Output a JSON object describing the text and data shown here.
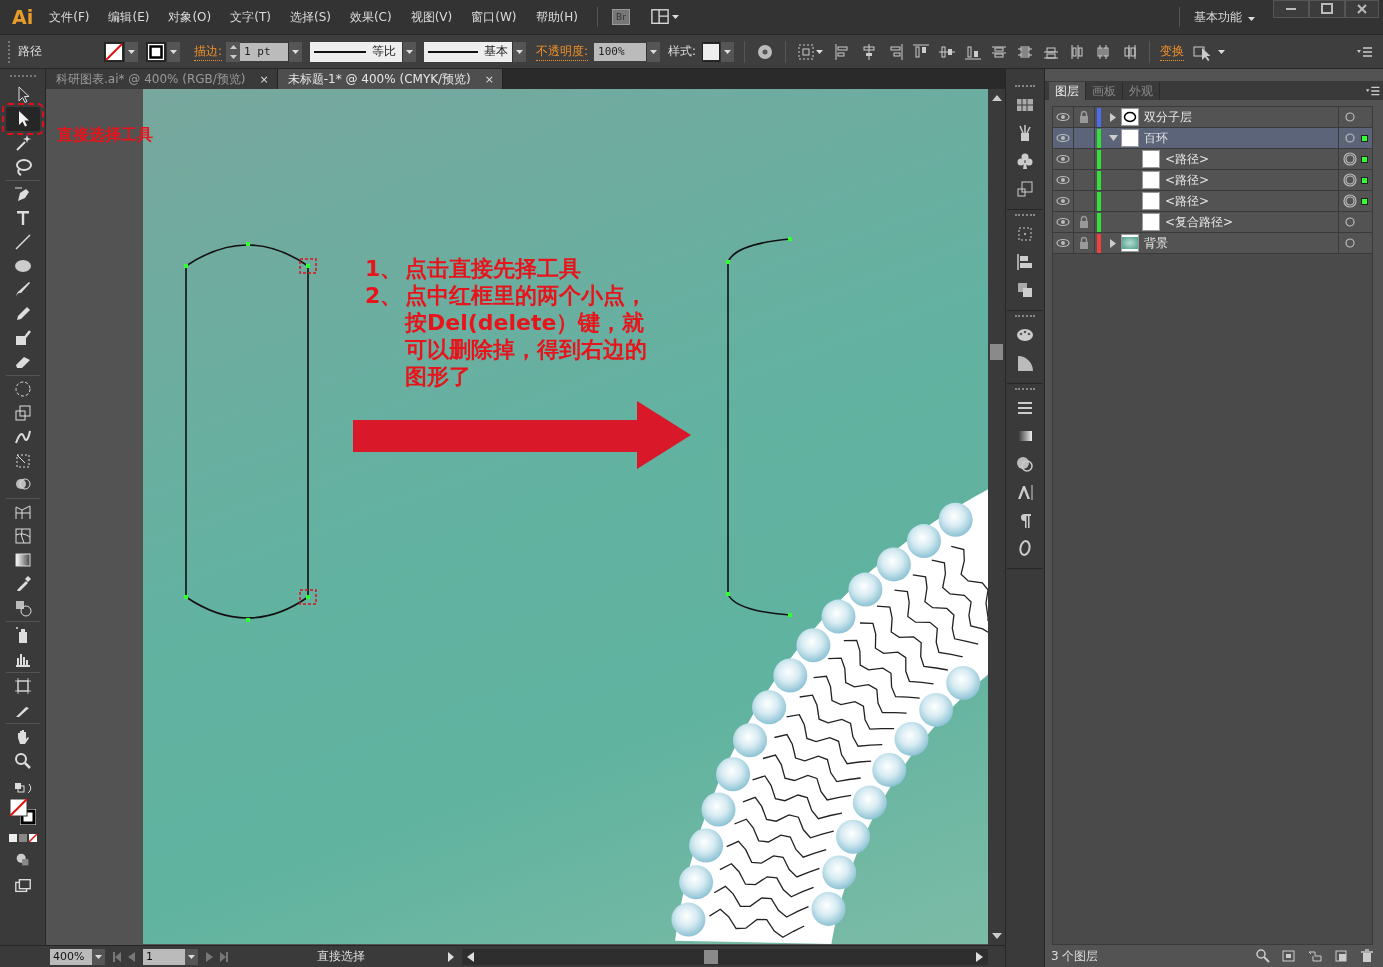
{
  "app": {
    "logo": "Ai"
  },
  "menu": [
    "文件(F)",
    "编辑(E)",
    "对象(O)",
    "文字(T)",
    "选择(S)",
    "效果(C)",
    "视图(V)",
    "窗口(W)",
    "帮助(H)"
  ],
  "bridge_button": "Br",
  "workspace": "基本功能",
  "control_bar": {
    "selection": "路径",
    "stroke_label": "描边:",
    "stroke_weight": "1 pt",
    "profile": "等比",
    "brush": "基本",
    "opacity_label": "不透明度:",
    "opacity": "100%",
    "style_label": "样式:",
    "transform": "变换"
  },
  "doc_tabs": [
    {
      "title": "科研图表.ai* @ 400% (RGB/预览)",
      "close": "×",
      "selected": false
    },
    {
      "title": "未标题-1* @ 400% (CMYK/预览)",
      "close": "×",
      "selected": true
    }
  ],
  "tools": [
    {
      "selected": false
    },
    {
      "selected": true
    },
    {
      "selected": false
    },
    {
      "selected": false
    },
    {
      "selected": false
    },
    {
      "selected": false
    },
    {
      "selected": false
    },
    {
      "selected": false
    },
    {
      "selected": false
    },
    {
      "selected": false
    },
    {
      "selected": false
    },
    {
      "selected": false
    },
    {
      "selected": false
    },
    {
      "selected": false
    },
    {
      "selected": false
    },
    {
      "selected": false
    },
    {
      "selected": false
    },
    {
      "selected": false
    },
    {
      "selected": false
    },
    {
      "selected": false
    },
    {
      "selected": false
    },
    {
      "selected": false
    },
    {
      "selected": false
    },
    {
      "selected": false
    },
    {
      "selected": false
    },
    {
      "selected": false
    },
    {
      "selected": false
    },
    {
      "selected": false
    }
  ],
  "canvas": {
    "callout": "直接选择工具",
    "steps": [
      {
        "number": "1、",
        "text": "点击直接先择工具"
      },
      {
        "number": "2、",
        "text": "点中红框里的两个小点，按Del(delete）键，就可以删除掉，得到右边的图形了"
      }
    ]
  },
  "layers": {
    "tabs": [
      {
        "label": "图层",
        "selected": true
      },
      {
        "label": "画板",
        "selected": false
      },
      {
        "label": "外观",
        "selected": false
      }
    ],
    "rows": [
      {
        "name": "双分子层",
        "visible": true,
        "locked": true,
        "color": "#4a6cf0",
        "expanded": false,
        "selected": false,
        "art_selected": false,
        "kind": "ellipse"
      },
      {
        "name": "百环",
        "visible": true,
        "locked": false,
        "color": "#33e03a",
        "expanded": true,
        "selected": true,
        "art_selected": true,
        "kind": "blank",
        "children": [
          {
            "name": "<路径>",
            "visible": true,
            "locked": false,
            "color": "#33e03a",
            "selected": false,
            "art_selected": true,
            "kind": "blank"
          },
          {
            "name": "<路径>",
            "visible": true,
            "locked": false,
            "color": "#33e03a",
            "selected": false,
            "art_selected": true,
            "kind": "blank"
          },
          {
            "name": "<路径>",
            "visible": true,
            "locked": false,
            "color": "#33e03a",
            "selected": false,
            "art_selected": true,
            "kind": "blank"
          },
          {
            "name": "<复合路径>",
            "visible": true,
            "locked": true,
            "color": "#33e03a",
            "selected": false,
            "art_selected": false,
            "kind": "blank"
          }
        ]
      },
      {
        "name": "背景",
        "visible": true,
        "locked": true,
        "color": "#f04040",
        "expanded": false,
        "selected": false,
        "art_selected": false,
        "kind": "gradient"
      }
    ],
    "count": "3 个图层"
  },
  "status_bar": {
    "zoom": "400%",
    "artboard": "1",
    "tool": "直接选择"
  }
}
